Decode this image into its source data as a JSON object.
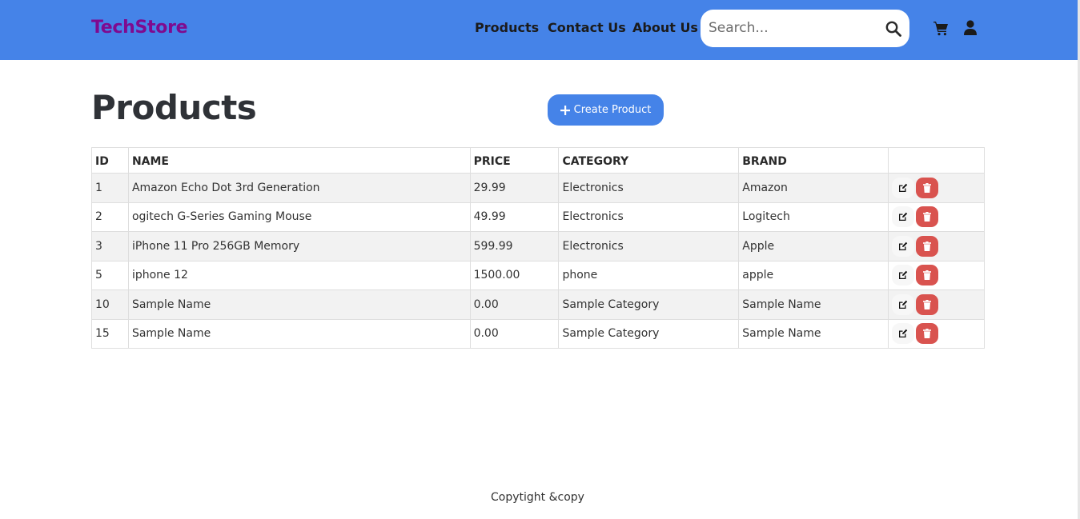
{
  "header": {
    "brand": "TechStore",
    "nav": {
      "products": "Products",
      "contact": "Contact Us",
      "about": "About Us"
    },
    "search": {
      "placeholder": "Search...",
      "value": ""
    },
    "icons": {
      "search": "search-icon",
      "cart": "cart-icon",
      "user": "user-icon"
    }
  },
  "main": {
    "title": "Products",
    "create_button": "Create Product",
    "table": {
      "columns": [
        "ID",
        "NAME",
        "PRICE",
        "CATEGORY",
        "BRAND",
        ""
      ],
      "rows": [
        {
          "id": "1",
          "name": "Amazon Echo Dot 3rd Generation",
          "price": "29.99",
          "category": "Electronics",
          "brand": "Amazon"
        },
        {
          "id": "2",
          "name": "ogitech G-Series Gaming Mouse",
          "price": "49.99",
          "category": "Electronics",
          "brand": "Logitech"
        },
        {
          "id": "3",
          "name": "iPhone 11 Pro 256GB Memory",
          "price": "599.99",
          "category": "Electronics",
          "brand": "Apple"
        },
        {
          "id": "5",
          "name": "iphone 12",
          "price": "1500.00",
          "category": "phone",
          "brand": "apple"
        },
        {
          "id": "10",
          "name": "Sample Name",
          "price": "0.00",
          "category": "Sample Category",
          "brand": "Sample Name"
        },
        {
          "id": "15",
          "name": "Sample Name",
          "price": "0.00",
          "category": "Sample Category",
          "brand": "Sample Name"
        }
      ]
    }
  },
  "footer": {
    "text": "Copytight &copy"
  },
  "colors": {
    "navbar": "#4583e8",
    "brand": "#7f0a8f",
    "primary_button": "#4583e8",
    "delete_button": "#d9534f",
    "stripe": "#f2f2f2"
  }
}
